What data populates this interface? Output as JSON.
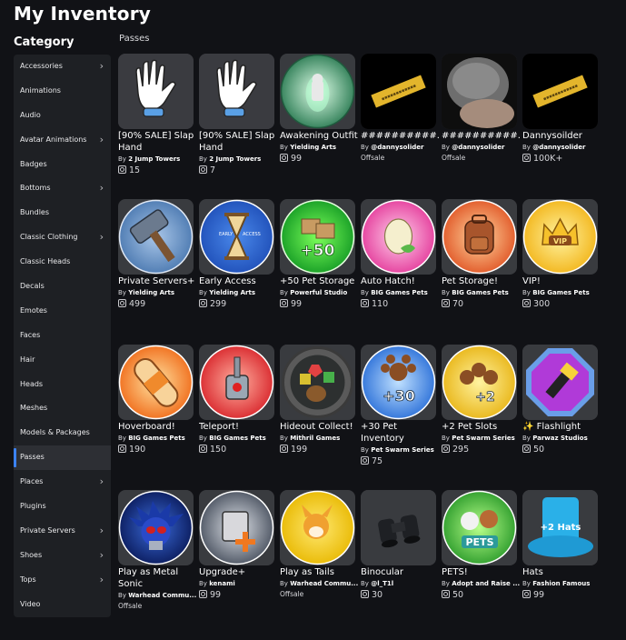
{
  "page": {
    "title": "My Inventory",
    "category_heading": "Category",
    "section": "Passes"
  },
  "sidebar": {
    "items": [
      {
        "label": "Accessories",
        "chevron": true
      },
      {
        "label": "Animations",
        "chevron": false
      },
      {
        "label": "Audio",
        "chevron": false
      },
      {
        "label": "Avatar Animations",
        "chevron": true
      },
      {
        "label": "Badges",
        "chevron": false
      },
      {
        "label": "Bottoms",
        "chevron": true
      },
      {
        "label": "Bundles",
        "chevron": false
      },
      {
        "label": "Classic Clothing",
        "chevron": true
      },
      {
        "label": "Classic Heads",
        "chevron": false
      },
      {
        "label": "Decals",
        "chevron": false
      },
      {
        "label": "Emotes",
        "chevron": false
      },
      {
        "label": "Faces",
        "chevron": false
      },
      {
        "label": "Hair",
        "chevron": false
      },
      {
        "label": "Heads",
        "chevron": false
      },
      {
        "label": "Meshes",
        "chevron": false
      },
      {
        "label": "Models & Packages",
        "chevron": false
      },
      {
        "label": "Passes",
        "chevron": false,
        "active": true
      },
      {
        "label": "Places",
        "chevron": true
      },
      {
        "label": "Plugins",
        "chevron": false
      },
      {
        "label": "Private Servers",
        "chevron": true
      },
      {
        "label": "Shoes",
        "chevron": true
      },
      {
        "label": "Tops",
        "chevron": true
      },
      {
        "label": "Video",
        "chevron": false
      }
    ]
  },
  "items": [
    {
      "name": "[90% SALE] Slap Hand",
      "by": "By",
      "creator": "2 Jump Towers",
      "price": "15",
      "status": "",
      "thumb": "glove-icon"
    },
    {
      "name": "[90% SALE] Slap Hand",
      "by": "By",
      "creator": "2 Jump Towers",
      "price": "7",
      "status": "",
      "thumb": "glove-icon"
    },
    {
      "name": "Awakening Outfit",
      "by": "By",
      "creator": "Yielding Arts",
      "price": "99",
      "status": "",
      "thumb": "aura-icon"
    },
    {
      "name": "##########...",
      "by": "By",
      "creator": "@dannysolider",
      "price": "",
      "status": "Offsale",
      "thumb": "ticket-icon"
    },
    {
      "name": "##########...",
      "by": "By",
      "creator": "@dannysolider",
      "price": "",
      "status": "Offsale",
      "thumb": "photo-icon"
    },
    {
      "name": "Dannysoilder",
      "by": "By",
      "creator": "@dannysolider",
      "price": "100K+",
      "status": "",
      "thumb": "ticket-icon"
    },
    {
      "name": "Private Servers+",
      "by": "By",
      "creator": "Yielding Arts",
      "price": "499",
      "status": "",
      "thumb": "hammer-icon"
    },
    {
      "name": "Early Access",
      "by": "By",
      "creator": "Yielding Arts",
      "price": "299",
      "status": "",
      "thumb": "hourglass-icon"
    },
    {
      "name": "+50 Pet Storage",
      "by": "By",
      "creator": "Powerful Studio",
      "price": "99",
      "status": "",
      "thumb": "boxes-icon"
    },
    {
      "name": "Auto Hatch!",
      "by": "By",
      "creator": "BIG Games Pets",
      "price": "110",
      "status": "",
      "thumb": "egg-icon"
    },
    {
      "name": "Pet Storage!",
      "by": "By",
      "creator": "BIG Games Pets",
      "price": "70",
      "status": "",
      "thumb": "backpack-icon"
    },
    {
      "name": "VIP!",
      "by": "By",
      "creator": "BIG Games Pets",
      "price": "300",
      "status": "",
      "thumb": "crown-icon"
    },
    {
      "name": "Hoverboard!",
      "by": "By",
      "creator": "BIG Games Pets",
      "price": "190",
      "status": "",
      "thumb": "hoverboard-icon"
    },
    {
      "name": "Teleport!",
      "by": "By",
      "creator": "BIG Games Pets",
      "price": "150",
      "status": "",
      "thumb": "teleport-icon"
    },
    {
      "name": "Hideout Collect!",
      "by": "By",
      "creator": "Mithril Games",
      "price": "199",
      "status": "",
      "thumb": "gems-icon"
    },
    {
      "name": "+30 Pet Inventory",
      "by": "By",
      "creator": "Pet Swarm Series",
      "price": "75",
      "status": "",
      "thumb": "paw-plus30-icon"
    },
    {
      "name": "+2 Pet Slots",
      "by": "By",
      "creator": "Pet Swarm Series",
      "price": "295",
      "status": "",
      "thumb": "paw-plus2-icon"
    },
    {
      "name": "✨ Flashlight",
      "by": "By",
      "creator": "Parwaz Studios",
      "price": "50",
      "status": "",
      "thumb": "flashlight-icon"
    },
    {
      "name": "Play as Metal Sonic",
      "by": "By",
      "creator": "Warhead Commu...",
      "price": "",
      "status": "Offsale",
      "thumb": "metal-sonic-icon"
    },
    {
      "name": "Upgrade+",
      "by": "By",
      "creator": "kenami",
      "price": "99",
      "status": "",
      "thumb": "upgrade-icon"
    },
    {
      "name": "Play as Tails",
      "by": "By",
      "creator": "Warhead Commu...",
      "price": "",
      "status": "Offsale",
      "thumb": "tails-icon"
    },
    {
      "name": "Binocular",
      "by": "By",
      "creator": "@l_T1l",
      "price": "30",
      "status": "",
      "thumb": "binocular-icon"
    },
    {
      "name": "PETS!",
      "by": "By",
      "creator": "Adopt and Raise ...",
      "price": "50",
      "status": "",
      "thumb": "pets-icon"
    },
    {
      "name": "Hats",
      "by": "By",
      "creator": "Fashion Famous",
      "price": "99",
      "status": "",
      "thumb": "hat-icon"
    }
  ],
  "thumb_text": {
    "early": "EARLY ACCESS",
    "plus50": "+50",
    "plus30": "+30",
    "plus2": "+2",
    "vip": "VIP",
    "pets": "PETS",
    "hats": "+2 Hats"
  },
  "colors": {
    "background": "#111216",
    "sidebar": "#1e2024",
    "active_accent": "#3b82f6",
    "tile": "#393b3f"
  }
}
